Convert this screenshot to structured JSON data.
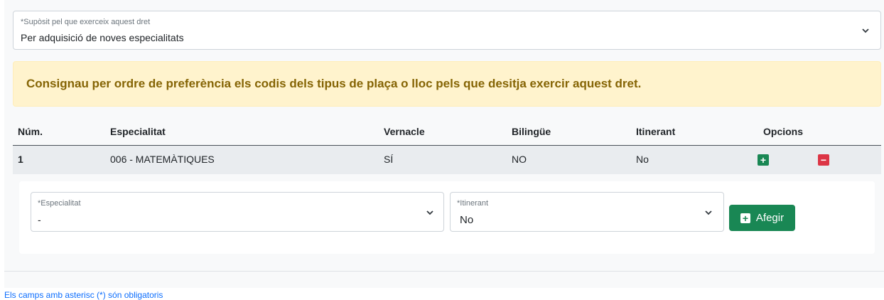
{
  "supposit": {
    "label": "*Supòsit pel que exerceix aquest dret",
    "value": "Per adquisició de noves especialitats"
  },
  "alert_text": "Consignau per ordre de preferència els codis dels tipus de plaça o lloc pels que desitja exercir aquest dret.",
  "table": {
    "headers": [
      "Núm.",
      "Especialitat",
      "Vernacle",
      "Bilingüe",
      "Itinerant",
      "Opcions"
    ],
    "rows": [
      [
        "1",
        "006 - MATEMÀTIQUES",
        "SÍ",
        "NO",
        "No"
      ]
    ]
  },
  "form": {
    "especialitat_label": "*Especialitat",
    "especialitat_value": "-",
    "itinerant_label": "*Itinerant",
    "itinerant_value": "No",
    "add_label": "Afegir"
  },
  "footnote": "Els camps amb asterisc (*) són obligatoris",
  "colors": {
    "add": "#198754",
    "remove": "#dc3545",
    "alert_bg": "#fff3cd",
    "alert_text": "#856404"
  },
  "icons": [
    "chevron-down-icon",
    "plus-square-icon",
    "minus-square-icon"
  ]
}
